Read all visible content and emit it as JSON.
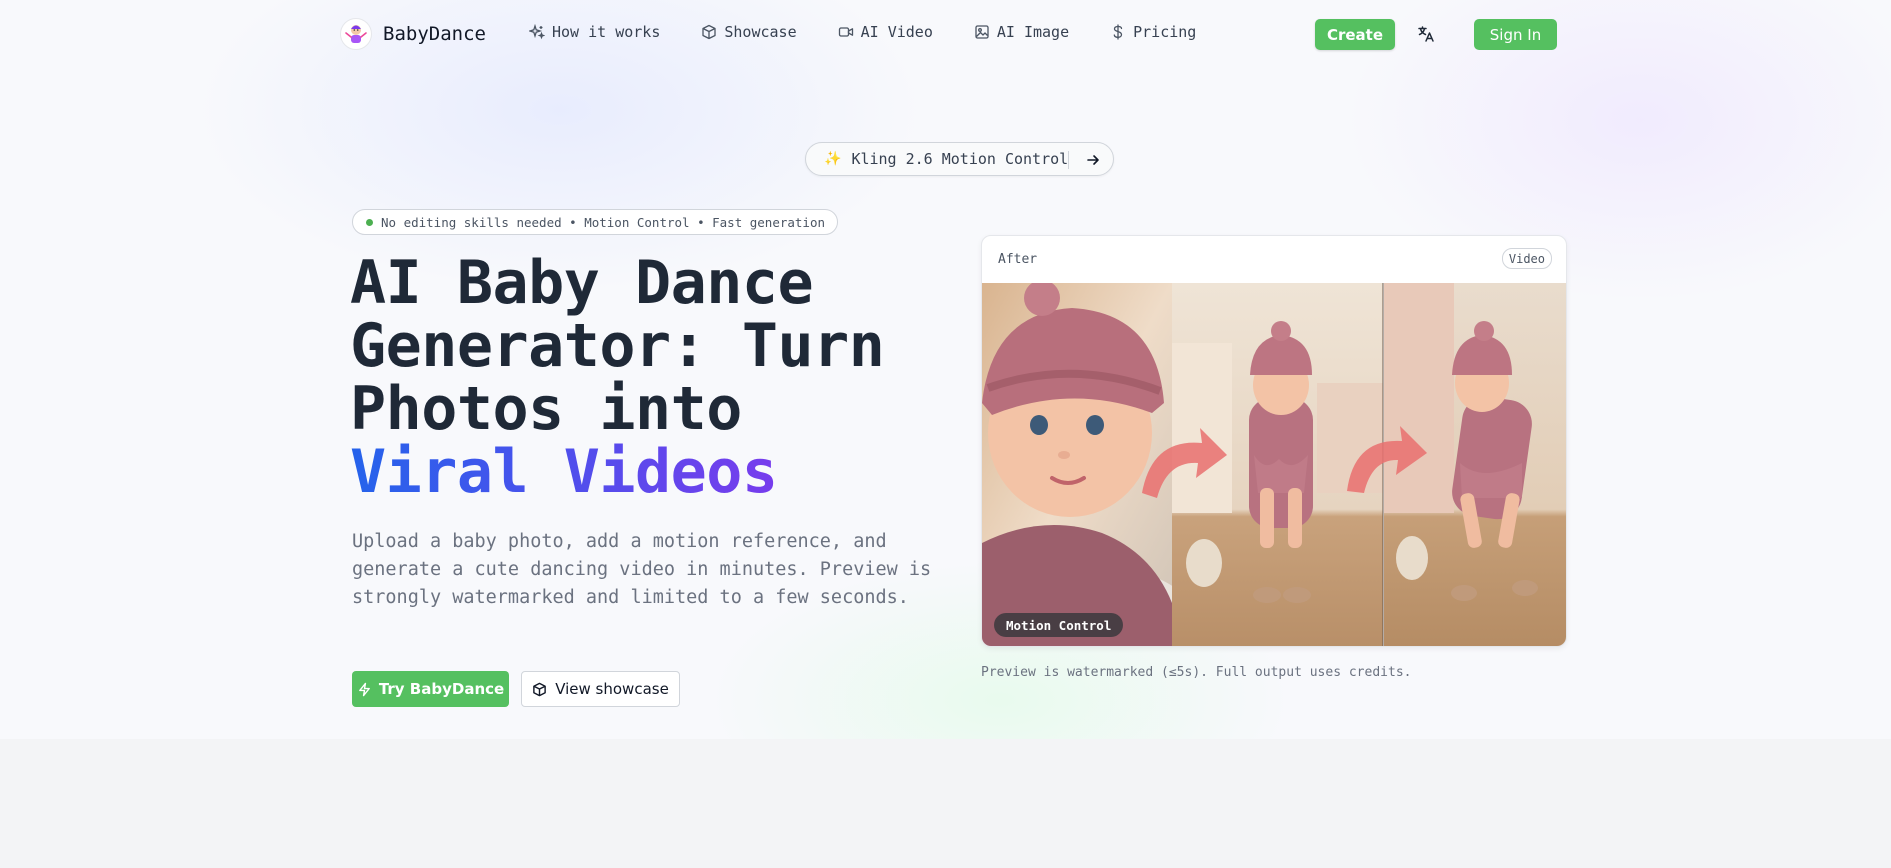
{
  "brand": {
    "name": "BabyDance"
  },
  "nav": {
    "links": [
      {
        "label": "How it works",
        "icon": "sparkles-icon"
      },
      {
        "label": "Showcase",
        "icon": "cube-icon"
      },
      {
        "label": "AI Video",
        "icon": "video-icon"
      },
      {
        "label": "AI Image",
        "icon": "image-icon"
      },
      {
        "label": "Pricing",
        "icon": "dollar-icon"
      }
    ],
    "create_label": "Create",
    "signin_label": "Sign In",
    "translate_icon": "translate-icon"
  },
  "announce": {
    "spark": "✨",
    "text": "Kling 2.6 Motion Control",
    "arrow_icon": "arrow-right-icon"
  },
  "hero": {
    "chip": "No editing skills needed • Motion Control • Fast generation",
    "headline_line1": "AI Baby Dance",
    "headline_line2": "Generator: Turn",
    "headline_line3": "Photos into",
    "headline_highlight": "Viral Videos",
    "lead": "Upload a baby photo, add a motion reference, and generate a cute dancing video in minutes. Preview is strongly watermarked and limited to a few seconds.",
    "try_label": "Try BabyDance",
    "view_label": "View showcase"
  },
  "preview": {
    "after_label": "After",
    "badge": "Video",
    "overlay_label": "Motion Control",
    "caption": "Preview is watermarked (≤5s). Full output uses credits."
  },
  "colors": {
    "accent_green": "#55c060",
    "gradient_start": "#2563eb",
    "gradient_end": "#7c3aed"
  }
}
